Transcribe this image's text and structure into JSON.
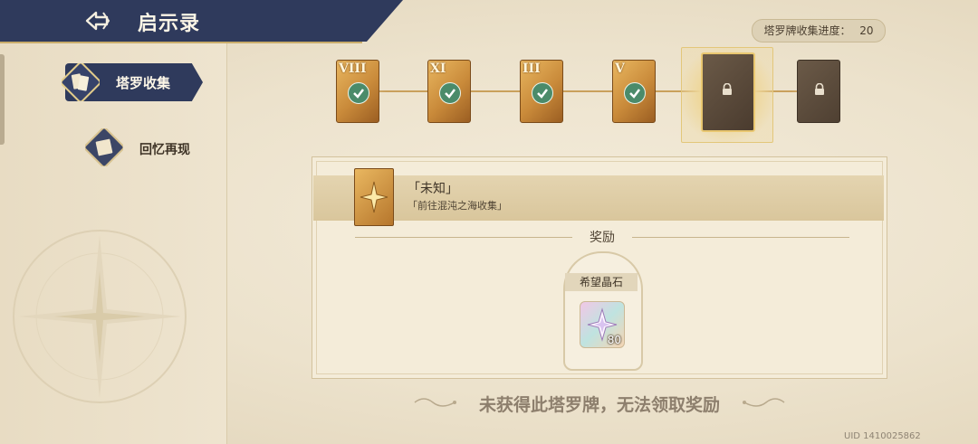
{
  "header": {
    "title": "启示录"
  },
  "sidebar": {
    "items": [
      {
        "label": "塔罗收集",
        "active": true
      },
      {
        "label": "回忆再现",
        "active": false
      }
    ]
  },
  "progress": {
    "label": "塔罗牌收集进度：",
    "value": "20"
  },
  "cards": [
    {
      "numeral": "VIII",
      "state": "collected"
    },
    {
      "numeral": "XI",
      "state": "collected"
    },
    {
      "numeral": "III",
      "state": "collected"
    },
    {
      "numeral": "V",
      "state": "collected"
    },
    {
      "numeral": "",
      "state": "locked-selected"
    },
    {
      "numeral": "",
      "state": "locked"
    }
  ],
  "detail": {
    "name": "「未知」",
    "description": "「前往混沌之海收集」",
    "reward_heading": "奖励",
    "reward": {
      "name": "希望晶石",
      "quantity": "80"
    }
  },
  "notice": "未获得此塔罗牌，无法领取奖励",
  "uid": "UID 1410025862",
  "colors": {
    "header_bg": "#2f3a5c",
    "accent_gold": "#c9a05c",
    "check_green": "#4b8b6a"
  }
}
